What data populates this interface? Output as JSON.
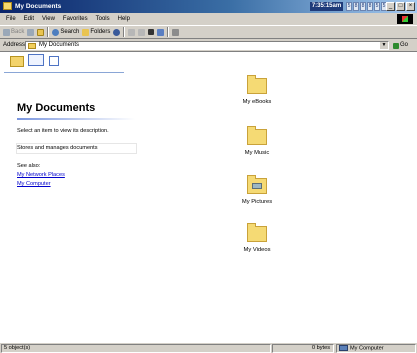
{
  "window": {
    "title": "My Documents",
    "clock": "7:35:15am",
    "taskbar_stats": [
      "5",
      "8",
      "8",
      "8",
      "5",
      "5"
    ],
    "controls": [
      "_",
      "□",
      "×"
    ]
  },
  "menu": [
    "File",
    "Edit",
    "View",
    "Favorites",
    "Tools",
    "Help"
  ],
  "toolbar": {
    "back": "Back",
    "search": "Search",
    "folders": "Folders"
  },
  "address": {
    "label": "Address",
    "value": "My Documents",
    "go": "Go"
  },
  "left_pane": {
    "title": "My Documents",
    "prompt": "Select an item to view its description.",
    "description": "Stores and manages documents",
    "see_also": "See also:",
    "links": [
      "My Network Places",
      "My Computer"
    ]
  },
  "files": [
    {
      "name": "My eBooks",
      "icon": "folder-icon"
    },
    {
      "name": "My Music",
      "icon": "folder-icon"
    },
    {
      "name": "My Pictures",
      "icon": "pictures-folder-icon"
    },
    {
      "name": "My Videos",
      "icon": "folder-icon"
    }
  ],
  "status": {
    "objects": "5 object(s)",
    "size": "0 bytes",
    "location": "My Computer"
  }
}
